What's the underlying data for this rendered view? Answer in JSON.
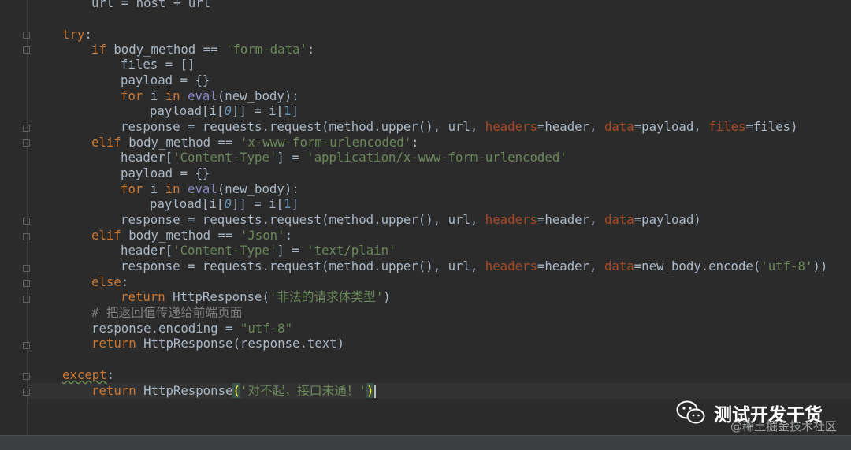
{
  "lines": {
    "l0": [
      "url = host + url"
    ],
    "l1": [
      "try",
      ":"
    ],
    "l2": [
      "if",
      " body_method == ",
      "'form-data'",
      ":"
    ],
    "l3": [
      "files = []"
    ],
    "l4": [
      "payload = {}"
    ],
    "l5": [
      "for",
      " i ",
      "in",
      " ",
      "eval",
      "(new_body):"
    ],
    "l6": [
      "payload[i[",
      "0",
      "]] = i[",
      "1",
      "]"
    ],
    "l7": [
      "response = requests.request(method.upper(), url, ",
      "headers",
      "=header, ",
      "data",
      "=payload, ",
      "files",
      "=files)"
    ],
    "l8": [
      "elif",
      " body_method == ",
      "'x-www-form-urlencoded'",
      ":"
    ],
    "l9": [
      "header[",
      "'Content-Type'",
      "] = ",
      "'application/x-www-form-urlencoded'"
    ],
    "l10": [
      "payload = {}"
    ],
    "l11": [
      "for",
      " i ",
      "in",
      " ",
      "eval",
      "(new_body):"
    ],
    "l12": [
      "payload[i[",
      "0",
      "]] = i[",
      "1",
      "]"
    ],
    "l13": [
      "response = requests.request(method.upper(), url, ",
      "headers",
      "=header, ",
      "data",
      "=payload)"
    ],
    "l14": [
      "elif",
      " body_method == ",
      "'Json'",
      ":"
    ],
    "l15": [
      "header[",
      "'Content-Type'",
      "] = ",
      "'text/plain'"
    ],
    "l16": [
      "response = requests.request(method.upper(), url, ",
      "headers",
      "=header, ",
      "data",
      "=new_body.encode(",
      "'utf-8'",
      "))"
    ],
    "l17": [
      "else",
      ":"
    ],
    "l18": [
      "return",
      " HttpResponse(",
      "'非法的请求体类型'",
      ")"
    ],
    "l19": [
      "# 把返回值传递给前端页面"
    ],
    "l20": [
      "response.encoding = ",
      "\"utf-8\""
    ],
    "l21": [
      "return",
      " HttpResponse(response.text)"
    ],
    "l22": [
      "except",
      ":"
    ],
    "l23": [
      "return",
      " HttpResponse",
      "(",
      "'对不起，接口未通！'",
      ")"
    ]
  },
  "watermark": {
    "title": "测试开发干货",
    "site": "@稀土掘金技术社区"
  },
  "colors": {
    "background": "#2b2b2b",
    "keyword": "#cc7832",
    "string": "#6a8759",
    "number": "#6897bb",
    "builtin": "#8888c6",
    "param": "#aa4926",
    "comment": "#808080",
    "text": "#a9b7c6"
  },
  "icons": [
    "wechat-icon",
    "fold-marker-icon"
  ]
}
